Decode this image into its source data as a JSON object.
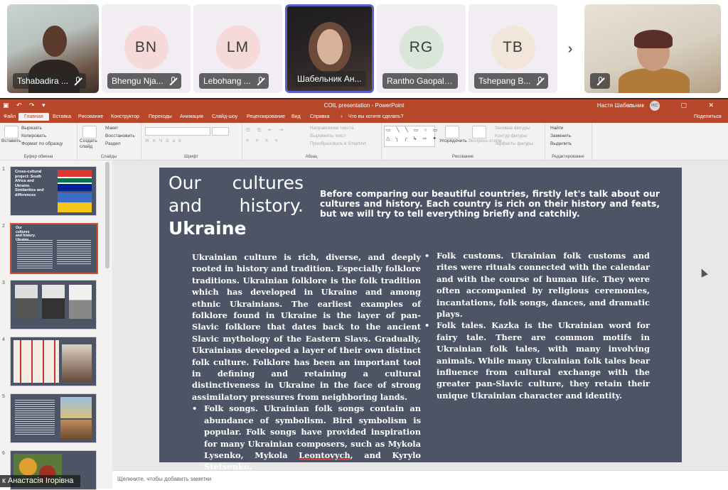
{
  "meeting": {
    "participants": [
      {
        "name": "Tshabadira ..."
      },
      {
        "name": "Bhengu Nja...",
        "initials": "BN",
        "color": "#f6d9d9"
      },
      {
        "name": "Lebohang ...",
        "initials": "LM",
        "color": "#f6d9d9"
      },
      {
        "name": "Шабельник Ан..."
      },
      {
        "name": "Rantho Gaopale...",
        "initials": "RG",
        "color": "#d9e6d9"
      },
      {
        "name": "Tshepang B...",
        "initials": "TB",
        "color": "#f1e6d9"
      }
    ],
    "bottom_label": "к Анастасія Ігорівна"
  },
  "ppt": {
    "window_title": "COIL presentation - PowerPoint",
    "user_name": "Настя Шабельник",
    "user_initials": "НШ",
    "share_label": "Поделиться",
    "tabs": [
      "Файл",
      "Главная",
      "Вставка",
      "Рисование",
      "Конструктор",
      "Переходы",
      "Анимация",
      "Слайд-шоу",
      "Рецензирование",
      "Вид",
      "Справка"
    ],
    "tell_me": "Что вы хотите сделать?",
    "ribbon": {
      "clipboard": {
        "name": "Буфер обмена",
        "paste": "Вставить",
        "cut": "Вырезать",
        "copy": "Копировать",
        "format": "Формат по образцу"
      },
      "slides": {
        "name": "Слайды",
        "new": "Создать слайд",
        "layout": "Макет",
        "reset": "Восстановить",
        "section": "Раздел"
      },
      "font": {
        "name": "Шрифт"
      },
      "paragraph": {
        "name": "Абзац",
        "direction": "Направление текста",
        "align": "Выровнять текст",
        "smartart": "Преобразовать в SmartArt"
      },
      "drawing": {
        "name": "Рисование",
        "arrange": "Упорядочить",
        "styles": "Экспресс-стили",
        "fill": "Заливка фигуры",
        "outline": "Контур фигуры",
        "effects": "Эффекты фигуры"
      },
      "editing": {
        "name": "Редактирование",
        "find": "Найти",
        "replace": "Заменить",
        "select": "Выделить"
      }
    },
    "notes_placeholder": "Щелкните, чтобы добавить заметки",
    "thumbnails": [
      {
        "num": "1",
        "text": "Cross-cultural project: South Africa and Ukraine. Similarities and differences"
      },
      {
        "num": "2",
        "text": "Our cultures and history. Ukraine"
      },
      {
        "num": "3"
      },
      {
        "num": "4"
      },
      {
        "num": "5"
      },
      {
        "num": "6"
      }
    ]
  },
  "slide": {
    "title_line1": "Our cultures",
    "title_line2": "and history.",
    "title_line3": "Ukraine",
    "intro": "Before comparing our beautiful countries, firstly let's talk about our cultures and history. Each country is rich on their history and feats, but we will try to tell everything briefly and catchily.",
    "left_paragraph": "Ukrainian culture is rich, diverse, and deeply rooted in history and tradition. Especially folklore traditions. Ukrainian folklore is the folk tradition which has developed in Ukraine and among ethnic Ukrainians. The earliest examples of folklore found in Ukraine is the layer of pan-Slavic folklore that dates back to the ancient Slavic mythology of the Eastern Slavs. Gradually, Ukrainians developed a layer of their own distinct folk culture. Folklore has been an important tool in defining and retaining a cultural distinctiveness in Ukraine in the face of strong assimilatory pressures from neighboring lands.",
    "left_bullet_a": "Folk songs. Ukrainian folk songs contain an abundance of symbolism. Bird symbolism is popular. Folk songs have provided inspiration for many Ukrainian composers, such as Mykola Lysenko, Mykola ",
    "left_bullet_ul": "Leontovych",
    "left_bullet_b": ", and Kyrylo Stetsenko.",
    "right_bullet1": "Folk customs. Ukrainian folk customs and rites were rituals connected with the calendar and with the course of human life. They were often accompanied by religious ceremonies, incantations, folk songs, dances, and dramatic plays.",
    "right_bullet2_a": "Folk tales. ",
    "right_bullet2_ul": "Kazka",
    "right_bullet2_b": " is the Ukrainian word for fairy tale. There are common motifs in Ukrainian folk tales, with many involving animals. While many Ukrainian folk tales bear influence from cultural exchange with the greater pan-Slavic culture, they retain their unique Ukrainian character and identity."
  }
}
